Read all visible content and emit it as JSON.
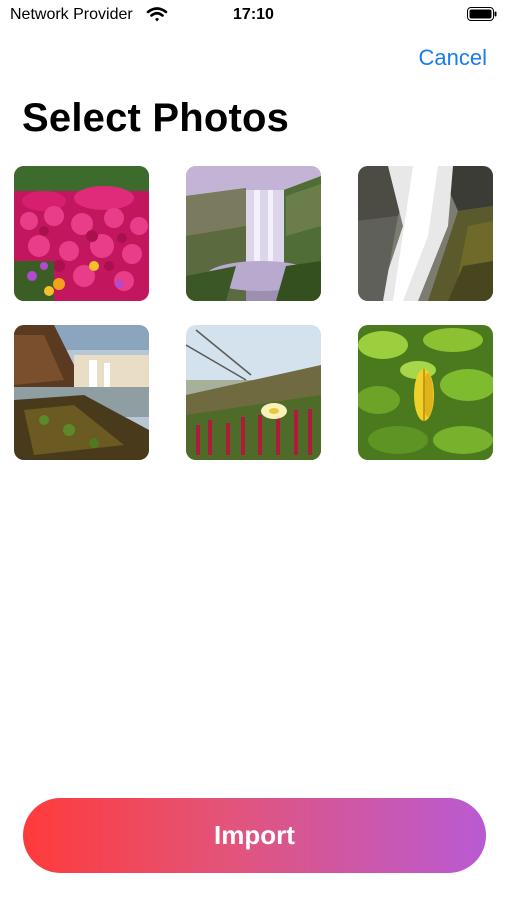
{
  "status_bar": {
    "carrier": "Network Provider",
    "time": "17:10",
    "wifi_icon": "wifi-icon",
    "battery_icon": "battery-icon"
  },
  "nav": {
    "cancel_label": "Cancel",
    "cancel_color": "#1b7bf5"
  },
  "title": "Select Photos",
  "photos": [
    {
      "icon": "photo-flowers-icon"
    },
    {
      "icon": "photo-waterfall-icon"
    },
    {
      "icon": "photo-waterfall-rocks-icon"
    },
    {
      "icon": "photo-waterfall-coast-icon"
    },
    {
      "icon": "photo-meadow-flowers-icon"
    },
    {
      "icon": "photo-leaves-icon"
    }
  ],
  "import": {
    "label": "Import",
    "gradient_start": "#ff3b3b",
    "gradient_end": "#b95ad4"
  }
}
